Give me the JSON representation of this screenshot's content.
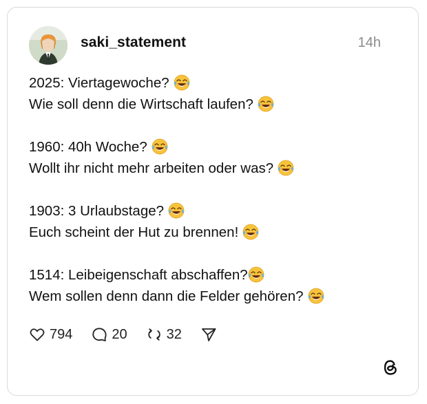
{
  "post": {
    "username": "saki_statement",
    "time": "14h",
    "lines": {
      "l1": "2025: Viertagewoche?",
      "l2": "Wie soll denn die Wirtschaft laufen?",
      "l3": "1960: 40h Woche?",
      "l4": "Wollt ihr nicht mehr arbeiten oder was?",
      "l5": "1903: 3 Urlaubstage?",
      "l6": "Euch scheint der Hut zu brennen!",
      "l7": "1514: Leibeigenschaft abschaffen?",
      "l8": "Wem sollen denn dann die Felder gehören?"
    },
    "emoji": "face-with-tears-of-joy",
    "stats": {
      "likes": "794",
      "replies": "20",
      "reposts": "32"
    }
  },
  "icons": {
    "like": "heart-icon",
    "reply": "comment-icon",
    "repost": "repost-icon",
    "share": "send-icon",
    "logo": "threads-logo-icon"
  },
  "colors": {
    "text": "#111111",
    "muted": "#8a8a8a",
    "border": "#d9d9d9",
    "emoji_face": "#f7c33c"
  }
}
